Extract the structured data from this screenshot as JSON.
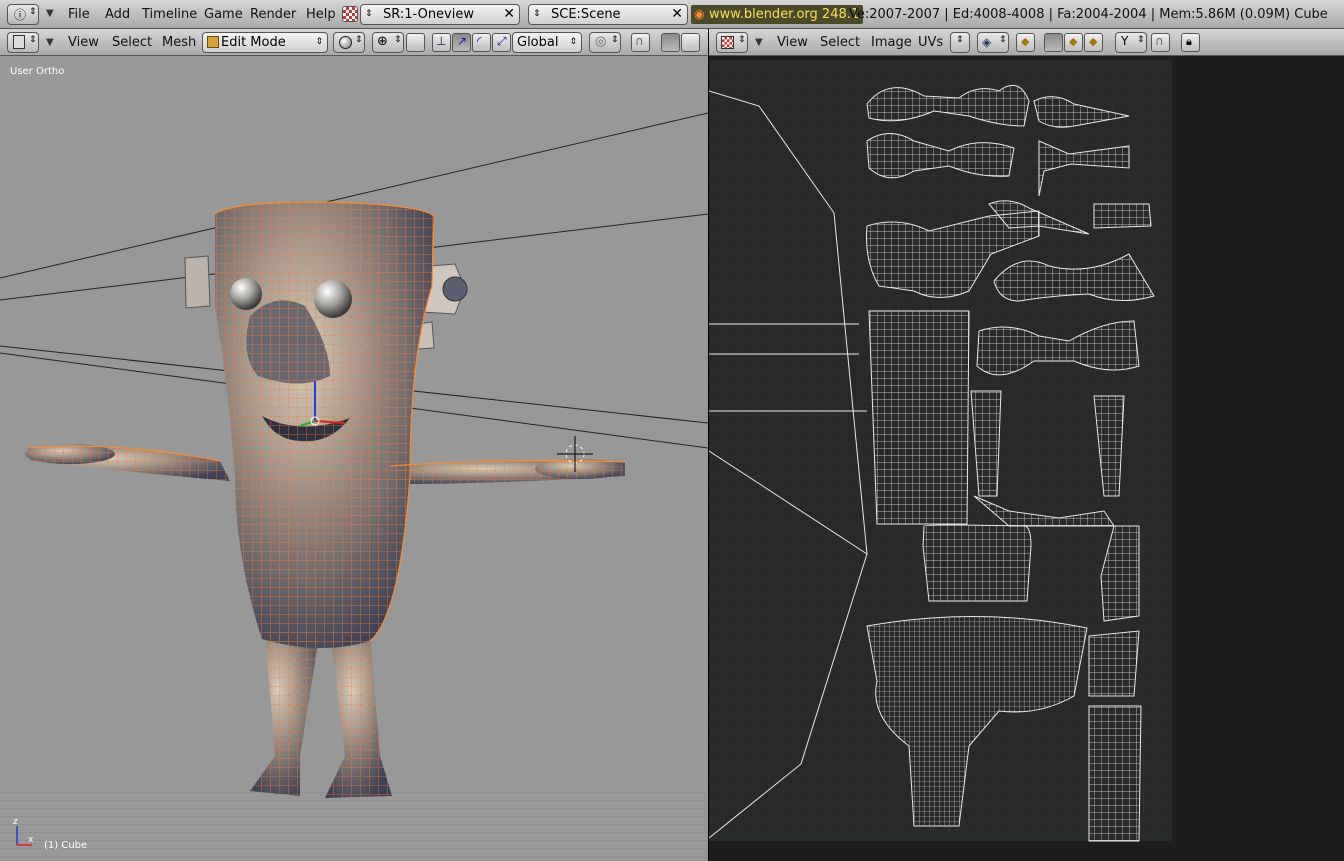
{
  "top": {
    "menus": [
      "File",
      "Add",
      "Timeline",
      "Game",
      "Render",
      "Help"
    ],
    "screen_field": "SR:1-Oneview",
    "scene_field": "SCE:Scene",
    "url": "www.blender.org 248.1",
    "stats": "Ve:2007-2007 | Ed:4008-4008 | Fa:2004-2004 | Mem:5.86M (0.09M) Cube"
  },
  "view3d_header": {
    "menus": [
      "View",
      "Select",
      "Mesh"
    ],
    "mode": "Edit Mode",
    "orientation": "Global"
  },
  "uv_header": {
    "menus": [
      "View",
      "Select",
      "Image",
      "UVs"
    ]
  },
  "viewport3d": {
    "view_label": "User Ortho",
    "object_label": "(1) Cube"
  },
  "colors": {
    "header_light": "#d6d6d6",
    "viewport_bg": "#989898",
    "uv_bg": "#1c1d1c",
    "uv_grid": "#2b2e2c",
    "wire": "#ff8a2a",
    "vertex": "#ff3030",
    "uv_wire": "#e8e8e8"
  }
}
